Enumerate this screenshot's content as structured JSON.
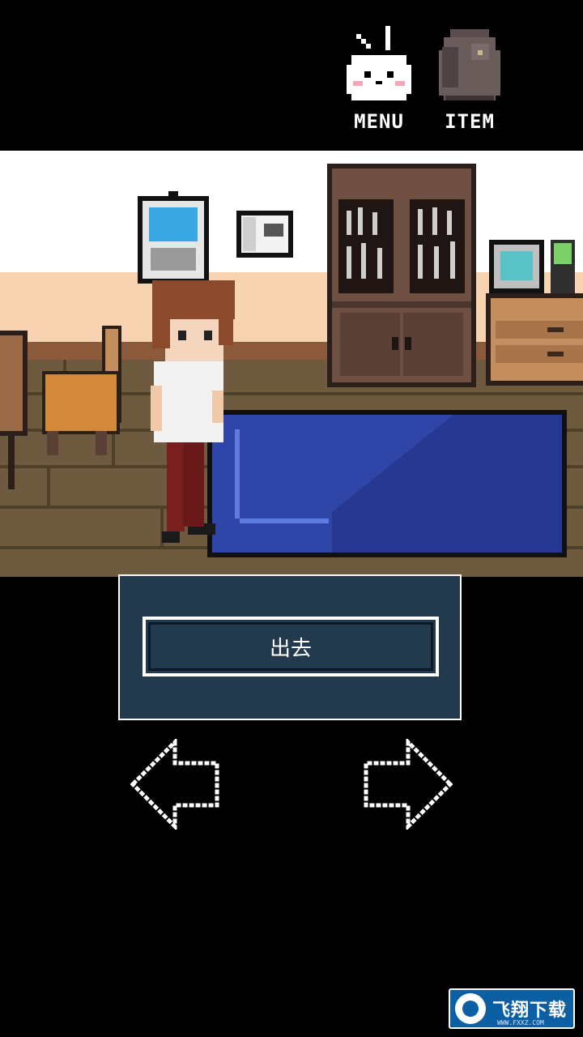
{
  "hud": {
    "menu_label": "MENU",
    "item_label": "ITEM"
  },
  "dialog": {
    "choice_label": "出去"
  },
  "navigation": {
    "left_icon": "left-arrow-icon",
    "right_icon": "right-arrow-icon"
  },
  "watermark": {
    "text": "飞翔下载",
    "sub": "WWW.FXXZ.COM"
  },
  "colors": {
    "background": "#000000",
    "dialog_bg": "#233a4e",
    "rug": "#2f45a8",
    "floor": "#6e5a3e",
    "wall": "#ffffff"
  }
}
